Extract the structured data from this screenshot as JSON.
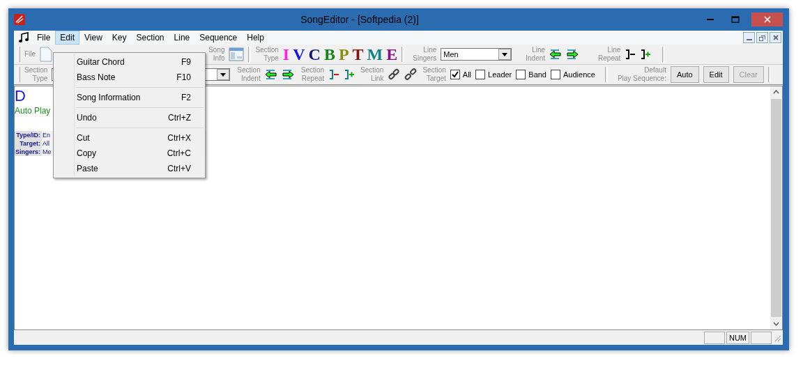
{
  "window": {
    "title": "SongEditor - [Softpedia (2)]"
  },
  "menu_bar": [
    {
      "label": "File",
      "selected": false
    },
    {
      "label": "Edit",
      "selected": true
    },
    {
      "label": "View",
      "selected": false
    },
    {
      "label": "Key",
      "selected": false
    },
    {
      "label": "Section",
      "selected": false
    },
    {
      "label": "Line",
      "selected": false
    },
    {
      "label": "Sequence",
      "selected": false
    },
    {
      "label": "Help",
      "selected": false
    }
  ],
  "toolbar_1": {
    "file_label": "File",
    "song_info_label": "Song\nInfo",
    "section_type_label": "Section\nType",
    "section_types": [
      {
        "label": "I",
        "color": "#ff22dd"
      },
      {
        "label": "V",
        "color": "#1414dc"
      },
      {
        "label": "C",
        "color": "#141478"
      },
      {
        "label": "B",
        "color": "#148214"
      },
      {
        "label": "P",
        "color": "#8c8c14"
      },
      {
        "label": "T",
        "color": "#821414"
      },
      {
        "label": "M",
        "color": "#148282"
      },
      {
        "label": "E",
        "color": "#821482"
      }
    ],
    "line_singers_label": "Line\nSingers",
    "line_singers_value": "Men",
    "line_indent_label": "Line\nIndent",
    "line_repeat_label": "Line\nRepeat"
  },
  "toolbar_2": {
    "section_type_label": "Section\nType",
    "section_indent_label": "Section\nIndent",
    "section_repeat_label": "Section\nRepeat",
    "section_link_label": "Section\nLink",
    "section_target_label": "Section\nTarget",
    "targets": [
      {
        "label": "All",
        "checked": true
      },
      {
        "label": "Leader",
        "checked": false
      },
      {
        "label": "Band",
        "checked": false
      },
      {
        "label": "Audience",
        "checked": false
      }
    ],
    "play_sequence_label": "Default\nPlay Sequence:",
    "buttons": [
      {
        "label": "Auto",
        "disabled": false
      },
      {
        "label": "Edit",
        "disabled": false
      },
      {
        "label": "Clear",
        "disabled": true
      }
    ]
  },
  "document": {
    "key": "D",
    "mode": "Auto Play",
    "info": [
      {
        "label": "Type/ID:",
        "value": "En"
      },
      {
        "label": "Target:",
        "value": "All"
      },
      {
        "label": "Singers:",
        "value": "Me"
      }
    ]
  },
  "edit_menu": [
    {
      "label": "Guitar Chord",
      "shortcut": "F9",
      "separator_before": false
    },
    {
      "label": "Bass Note",
      "shortcut": "F10",
      "separator_before": false
    },
    {
      "label": "Song Information",
      "shortcut": "F2",
      "separator_before": true
    },
    {
      "label": "Undo",
      "shortcut": "Ctrl+Z",
      "separator_before": true
    },
    {
      "label": "Cut",
      "shortcut": "Ctrl+X",
      "separator_before": true
    },
    {
      "label": "Copy",
      "shortcut": "Ctrl+C",
      "separator_before": false
    },
    {
      "label": "Paste",
      "shortcut": "Ctrl+V",
      "separator_before": false
    }
  ],
  "status_bar": {
    "num": "NUM"
  }
}
